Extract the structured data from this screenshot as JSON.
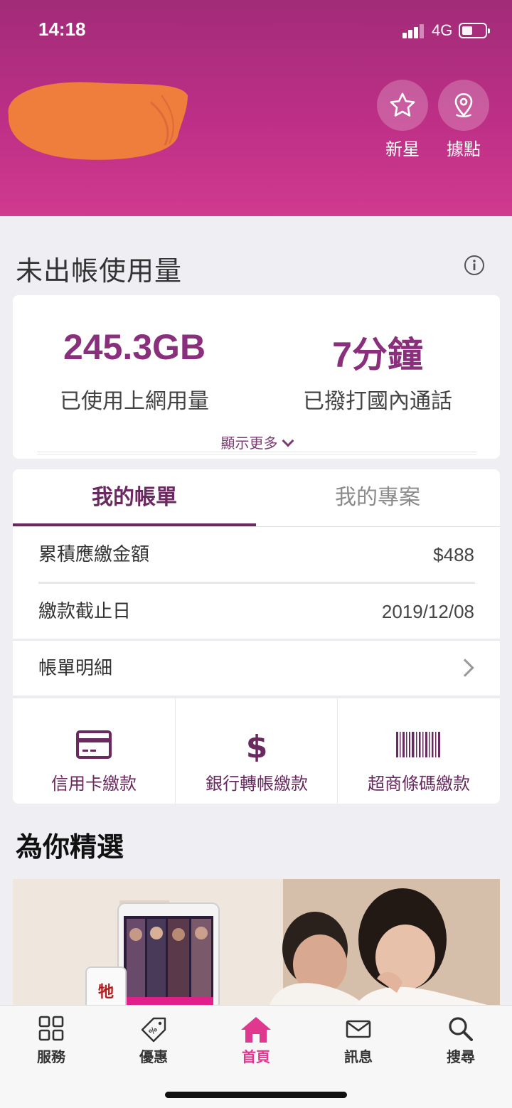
{
  "status_bar": {
    "time": "14:18",
    "network": "4G"
  },
  "header": {
    "buttons": [
      {
        "label": "新星",
        "icon": "star-icon"
      },
      {
        "label": "據點",
        "icon": "location-pin-icon"
      }
    ]
  },
  "usage": {
    "title": "未出帳使用量",
    "data_value": "245.3GB",
    "data_label": "已使用上網用量",
    "call_value": "7分鐘",
    "call_label": "已撥打國內通話",
    "show_more": "顯示更多"
  },
  "bill": {
    "tabs": [
      {
        "label": "我的帳單",
        "active": true
      },
      {
        "label": "我的專案",
        "active": false
      }
    ],
    "rows": [
      {
        "label": "累積應繳金額",
        "value": "$488"
      },
      {
        "label": "繳款截止日",
        "value": "2019/12/08"
      },
      {
        "label": "帳單明細"
      }
    ],
    "payments": [
      {
        "label": "信用卡繳款",
        "icon": "credit-card-icon"
      },
      {
        "label": "銀行轉帳繳款",
        "icon": "dollar-icon"
      },
      {
        "label": "超商條碼繳款",
        "icon": "barcode-icon"
      }
    ]
  },
  "picks": {
    "title": "為你精選",
    "banner_text": "牠"
  },
  "tab_bar": {
    "items": [
      {
        "label": "服務",
        "icon": "grid-icon"
      },
      {
        "label": "優惠",
        "icon": "coupon-icon"
      },
      {
        "label": "首頁",
        "icon": "home-icon",
        "active": true
      },
      {
        "label": "訊息",
        "icon": "mail-icon"
      },
      {
        "label": "搜尋",
        "icon": "search-icon"
      }
    ]
  },
  "colors": {
    "brand": "#c1307f",
    "accent_purple": "#8a2f7c",
    "active_tab": "#e0388f",
    "background": "#efeef3"
  }
}
